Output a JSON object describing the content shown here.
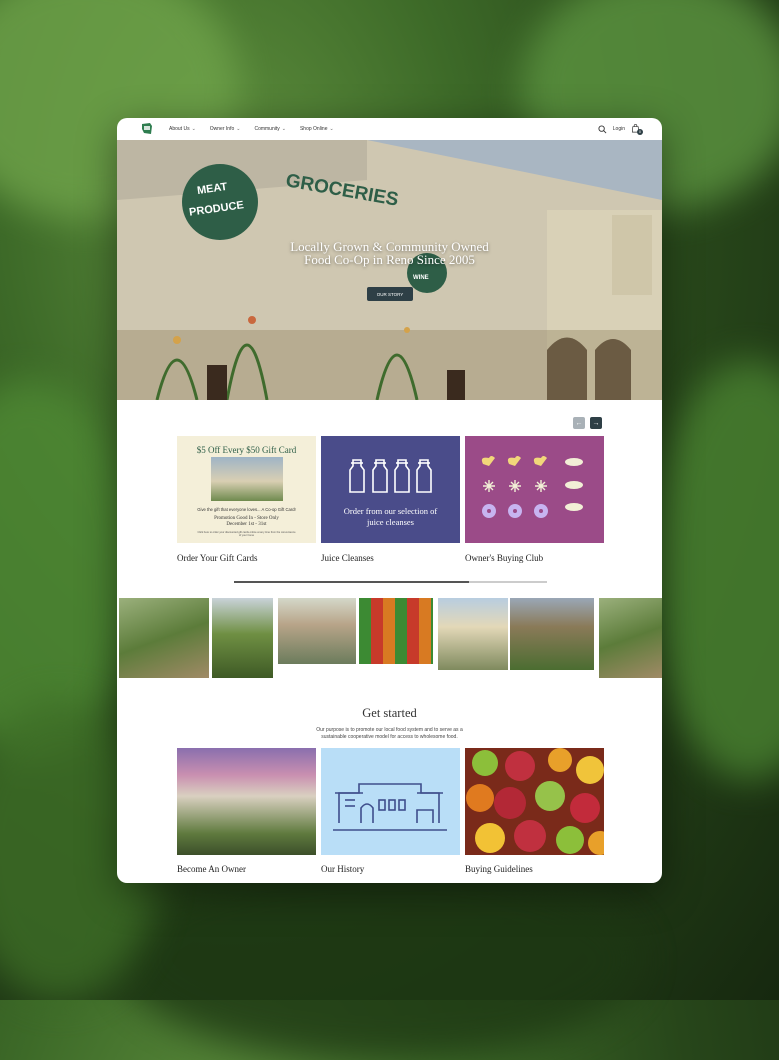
{
  "nav": {
    "menu": [
      {
        "label": "About Us"
      },
      {
        "label": "Owner Info"
      },
      {
        "label": "Community"
      },
      {
        "label": "Shop Online"
      }
    ],
    "login": "Login",
    "cart_count": "0"
  },
  "hero": {
    "heading": "Locally Grown & Community Owned Food Co-Op in Reno Since 2005",
    "button": "OUR STORY",
    "sign_meat": "MEAT",
    "sign_produce": "PRODUCE",
    "sign_groceries": "GROCERIES",
    "sign_wine": "WINE"
  },
  "carousel": {
    "prev": "←",
    "next": "→",
    "progress": 0.75
  },
  "features": [
    {
      "caption": "Order Your Gift Cards",
      "promo_title": "$5 Off Every $50 Gift Card",
      "promo_line": "Give the gift that everyone loves... A Co-op Gift Card!",
      "promo_dates": "Promotion Good In - Store Only",
      "promo_range": "December 1st - 31st",
      "promo_fine": "Click here to order your discounted gift cards online at any time from the convenience of your home"
    },
    {
      "caption": "Juice Cleanses",
      "tile_text": "Order from our selection of juice cleanses"
    },
    {
      "caption": "Owner's Buying Club"
    }
  ],
  "get_started": {
    "title": "Get started",
    "subtitle": "Our purpose is to promote our local food system and to serve as a sustainable cooperative model for access to wholesome food.",
    "items": [
      {
        "caption": "Become An Owner"
      },
      {
        "caption": "Our History"
      },
      {
        "caption": "Buying Guidelines"
      }
    ]
  },
  "colors": {
    "brand_green": "#2e5e47",
    "juice_bg": "#4a4c8a",
    "club_bg": "#9b4b88",
    "history_bg": "#b9def7",
    "button_dark": "#2e3f46"
  }
}
